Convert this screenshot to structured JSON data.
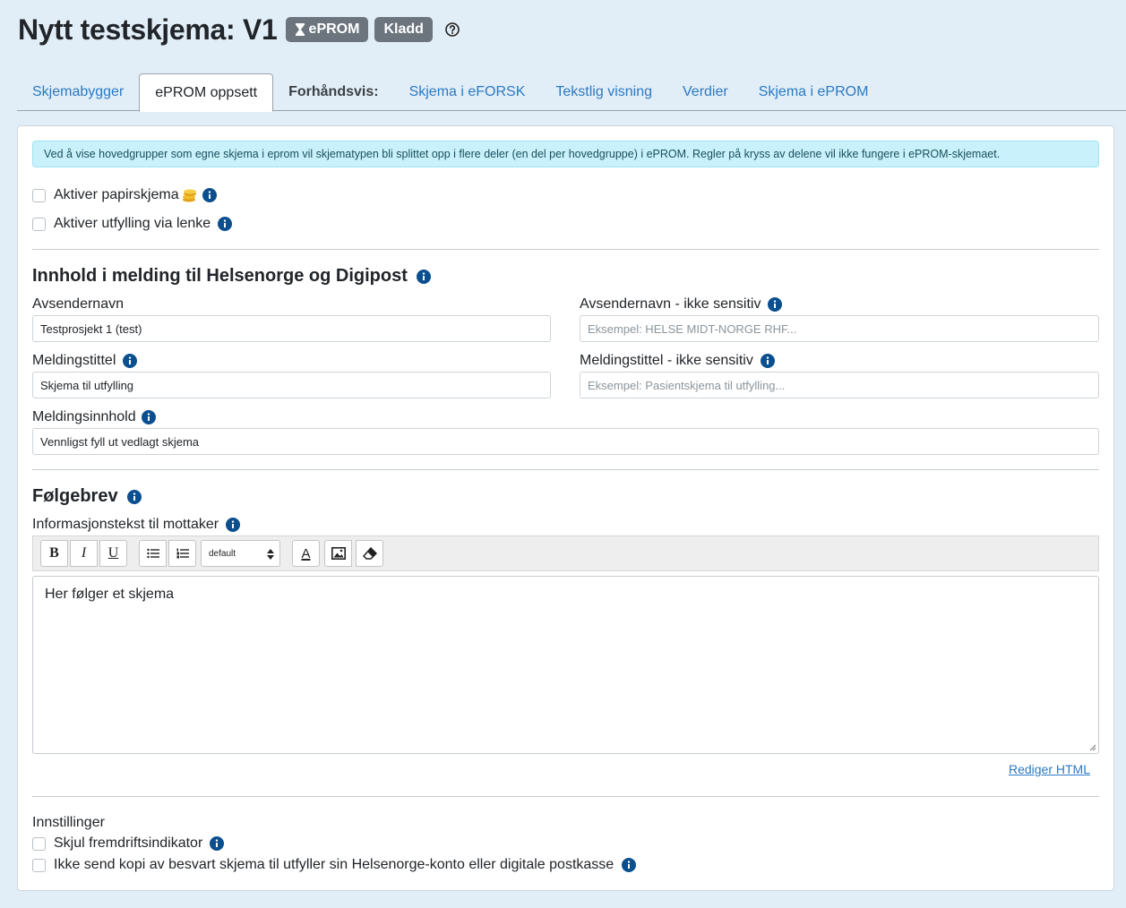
{
  "header": {
    "title": "Nytt testskjema: V1",
    "badge_eprom": "ePROM",
    "badge_status": "Kladd"
  },
  "tabs": [
    {
      "label": "Skjemabygger"
    },
    {
      "label": "ePROM oppsett"
    },
    {
      "label": "Forhåndsvis:"
    },
    {
      "label": "Skjema i eFORSK"
    },
    {
      "label": "Tekstlig visning"
    },
    {
      "label": "Verdier"
    },
    {
      "label": "Skjema i ePROM"
    }
  ],
  "alert": "Ved å vise hovedgrupper som egne skjema i eprom vil skjematypen bli splittet opp i flere deler (en del per hovedgruppe) i ePROM. Regler på kryss av delene vil ikke fungere i ePROM-skjemaet.",
  "options": {
    "paper_form": "Aktiver papirskjema",
    "link_fill": "Aktiver utfylling via lenke"
  },
  "message": {
    "heading": "Innhold i melding til Helsenorge og Digipost",
    "sender_label": "Avsendernavn",
    "sender_value": "Testprosjekt 1 (test)",
    "sender_ns_label": "Avsendernavn - ikke sensitiv",
    "sender_ns_placeholder": "Eksempel: HELSE MIDT-NORGE RHF...",
    "title_label": "Meldingstittel",
    "title_value": "Skjema til utfylling",
    "title_ns_label": "Meldingstittel - ikke sensitiv",
    "title_ns_placeholder": "Eksempel: Pasientskjema til utfylling...",
    "content_label": "Meldingsinnhold",
    "content_value": "Vennligst fyll ut vedlagt skjema"
  },
  "cover_letter": {
    "heading": "Følgebrev",
    "info_label": "Informasjonstekst til mottaker",
    "toolbar": {
      "bold": "B",
      "italic": "I",
      "underline": "U",
      "font_select": "default",
      "font_color": "A"
    },
    "editor_text": "Her følger et skjema",
    "edit_html": "Rediger HTML"
  },
  "settings": {
    "heading": "Innstillinger",
    "hide_progress": "Skjul fremdriftsindikator",
    "no_copy": "Ikke send kopi av besvart skjema til utfyller sin Helsenorge-konto eller digitale postkasse"
  },
  "colors": {
    "link": "#2a79c4",
    "info_icon": "#0b4f8f",
    "badge": "#6c757d",
    "alert_bg": "#c8f1fb"
  }
}
